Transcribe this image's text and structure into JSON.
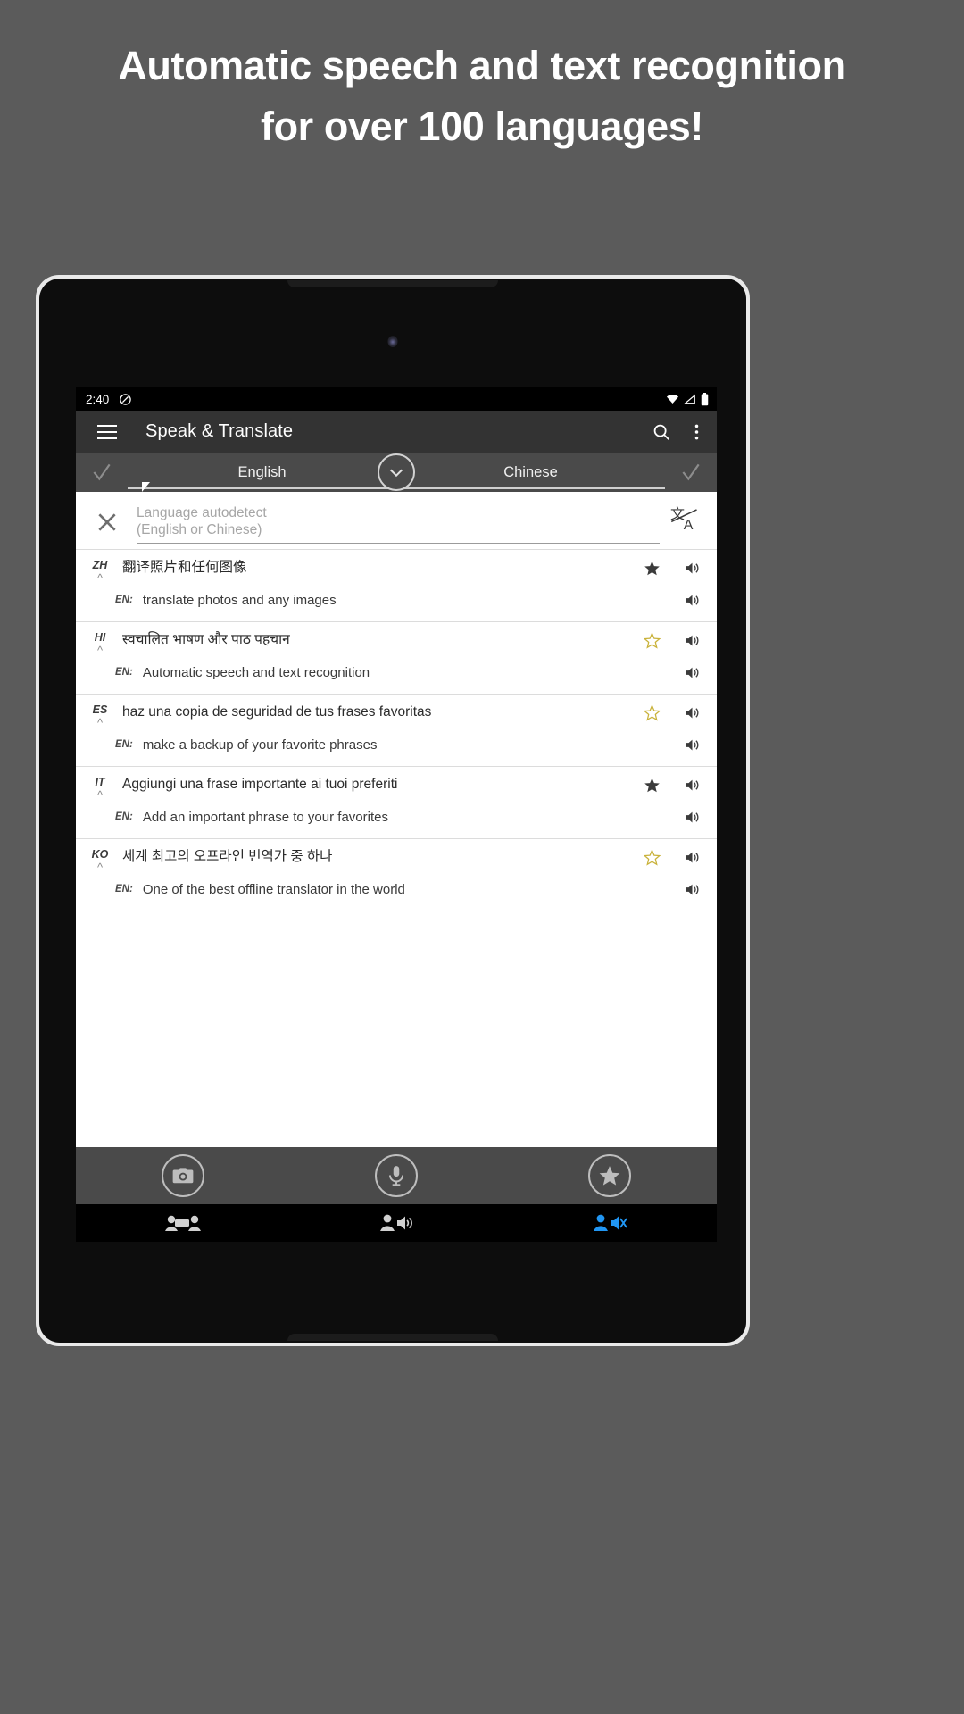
{
  "promo": {
    "headline": "Automatic speech and text recognition for over 100 languages!"
  },
  "statusbar": {
    "time": "2:40",
    "icons": [
      "dnd-icon",
      "wifi-icon",
      "signal-icon",
      "battery-icon"
    ]
  },
  "appbar": {
    "menu_icon": "hamburger-menu-icon",
    "title": "Speak & Translate",
    "search_icon": "search-icon",
    "overflow_icon": "more-vertical-icon"
  },
  "language_bar": {
    "source_language": "English",
    "target_language": "Chinese",
    "source_check_icon": "check-icon",
    "target_check_icon": "check-icon",
    "swap_icon": "chevron-down-icon"
  },
  "input": {
    "clear_icon": "close-x-icon",
    "placeholder_line1": "Language autodetect",
    "placeholder_line2": "(English or Chinese)",
    "value": "",
    "translate_icon": "translate-icon"
  },
  "entries": [
    {
      "source_lang": "ZH",
      "source_text": "翻译照片和任何图像",
      "target_lang": "EN:",
      "target_text": "translate photos and any images",
      "favorite": true,
      "star_color": "#3b3b3b",
      "speaker_icon": "volume-icon"
    },
    {
      "source_lang": "HI",
      "source_text": "स्वचालित भाषण और पाठ पहचान",
      "target_lang": "EN:",
      "target_text": "Automatic speech and text recognition",
      "favorite": false,
      "star_color": "#c9b23a",
      "speaker_icon": "volume-icon"
    },
    {
      "source_lang": "ES",
      "source_text": "haz una copia de seguridad de tus frases favoritas",
      "target_lang": "EN:",
      "target_text": "make a backup of your favorite phrases",
      "favorite": false,
      "star_color": "#c9b23a",
      "speaker_icon": "volume-icon"
    },
    {
      "source_lang": "IT",
      "source_text": "Aggiungi una frase importante ai tuoi preferiti",
      "target_lang": "EN:",
      "target_text": "Add an important phrase to your favorites",
      "favorite": true,
      "star_color": "#3b3b3b",
      "speaker_icon": "volume-icon"
    },
    {
      "source_lang": "KO",
      "source_text": "세계 최고의 오프라인 번역가 중 하나",
      "target_lang": "EN:",
      "target_text": "One of the best offline translator in the world",
      "favorite": false,
      "star_color": "#c9b23a",
      "speaker_icon": "volume-icon"
    }
  ],
  "action_bar": {
    "camera_icon": "camera-icon",
    "microphone_icon": "microphone-icon",
    "favorites_icon": "star-icon"
  },
  "nav_bar": {
    "items": [
      {
        "icon": "conversation-icon",
        "active": false
      },
      {
        "icon": "speaker-person-icon",
        "active": false
      },
      {
        "icon": "voice-person-icon",
        "active": true
      }
    ],
    "active_color": "#2196f3",
    "inactive_color": "#d0d0d0"
  },
  "colors": {
    "page_background": "#5b5b5b",
    "appbar": "#333333",
    "langbar": "#4a4a4a",
    "screen": "#ffffff"
  }
}
